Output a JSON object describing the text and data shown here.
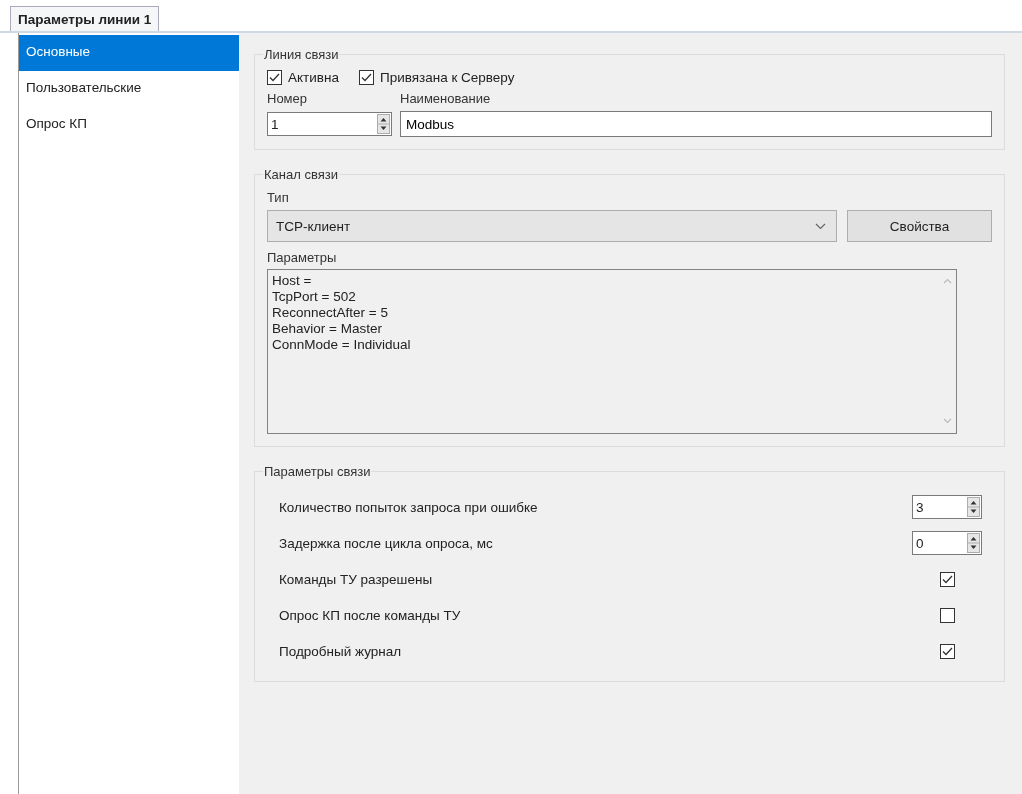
{
  "tabs": [
    {
      "label": "Параметры линии 1",
      "selected": true
    }
  ],
  "sidebar": {
    "items": [
      {
        "label": "Основные",
        "selected": true
      },
      {
        "label": "Пользовательские",
        "selected": false
      },
      {
        "label": "Опрос КП",
        "selected": false
      }
    ]
  },
  "line_group": {
    "title": "Линия связи",
    "checkboxes": [
      {
        "label": "Активна",
        "checked": true
      },
      {
        "label": "Привязана к Серверу",
        "checked": true
      }
    ],
    "number": {
      "label": "Номер",
      "value": "1"
    },
    "name": {
      "label": "Наименование",
      "value": "Modbus"
    }
  },
  "channel_group": {
    "title": "Канал связи",
    "type": {
      "label": "Тип",
      "value": "TCP-клиент"
    },
    "properties_button": "Свойства",
    "parameters": {
      "label": "Параметры",
      "lines": [
        "Host =",
        "TcpPort = 502",
        "ReconnectAfter = 5",
        "Behavior = Master",
        "ConnMode = Individual"
      ]
    }
  },
  "comm_group": {
    "title": "Параметры связи",
    "rows": [
      {
        "kind": "spin",
        "label": "Количество попыток запроса при ошибке",
        "value": "3"
      },
      {
        "kind": "spin",
        "label": "Задержка после цикла опроса, мс",
        "value": "0"
      },
      {
        "kind": "check",
        "label": "Команды ТУ разрешены",
        "checked": true
      },
      {
        "kind": "check",
        "label": "Опрос КП после команды ТУ",
        "checked": false
      },
      {
        "kind": "check",
        "label": "Подробный журнал",
        "checked": true
      }
    ]
  }
}
